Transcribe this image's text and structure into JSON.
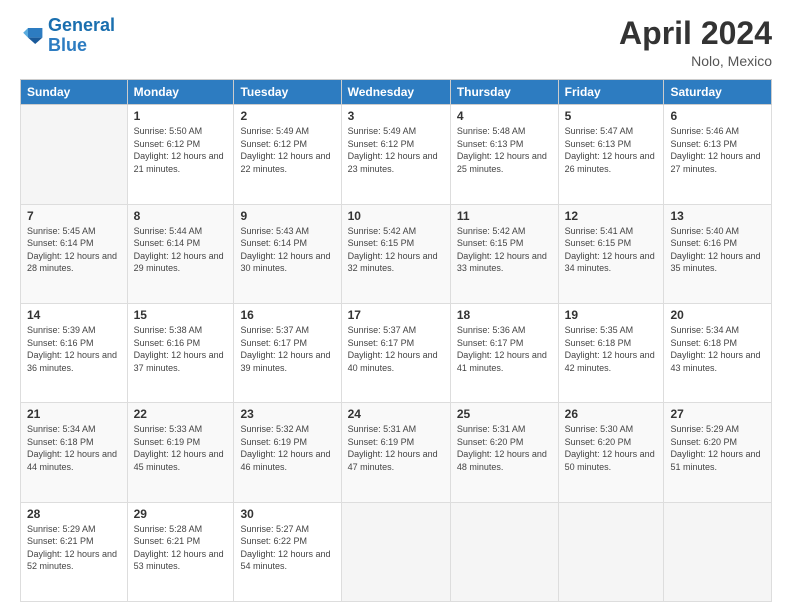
{
  "header": {
    "logo_line1": "General",
    "logo_line2": "Blue",
    "month_title": "April 2024",
    "location": "Nolo, Mexico"
  },
  "weekdays": [
    "Sunday",
    "Monday",
    "Tuesday",
    "Wednesday",
    "Thursday",
    "Friday",
    "Saturday"
  ],
  "weeks": [
    [
      {
        "day": "",
        "sunrise": "",
        "sunset": "",
        "daylight": ""
      },
      {
        "day": "1",
        "sunrise": "Sunrise: 5:50 AM",
        "sunset": "Sunset: 6:12 PM",
        "daylight": "Daylight: 12 hours and 21 minutes."
      },
      {
        "day": "2",
        "sunrise": "Sunrise: 5:49 AM",
        "sunset": "Sunset: 6:12 PM",
        "daylight": "Daylight: 12 hours and 22 minutes."
      },
      {
        "day": "3",
        "sunrise": "Sunrise: 5:49 AM",
        "sunset": "Sunset: 6:12 PM",
        "daylight": "Daylight: 12 hours and 23 minutes."
      },
      {
        "day": "4",
        "sunrise": "Sunrise: 5:48 AM",
        "sunset": "Sunset: 6:13 PM",
        "daylight": "Daylight: 12 hours and 25 minutes."
      },
      {
        "day": "5",
        "sunrise": "Sunrise: 5:47 AM",
        "sunset": "Sunset: 6:13 PM",
        "daylight": "Daylight: 12 hours and 26 minutes."
      },
      {
        "day": "6",
        "sunrise": "Sunrise: 5:46 AM",
        "sunset": "Sunset: 6:13 PM",
        "daylight": "Daylight: 12 hours and 27 minutes."
      }
    ],
    [
      {
        "day": "7",
        "sunrise": "Sunrise: 5:45 AM",
        "sunset": "Sunset: 6:14 PM",
        "daylight": "Daylight: 12 hours and 28 minutes."
      },
      {
        "day": "8",
        "sunrise": "Sunrise: 5:44 AM",
        "sunset": "Sunset: 6:14 PM",
        "daylight": "Daylight: 12 hours and 29 minutes."
      },
      {
        "day": "9",
        "sunrise": "Sunrise: 5:43 AM",
        "sunset": "Sunset: 6:14 PM",
        "daylight": "Daylight: 12 hours and 30 minutes."
      },
      {
        "day": "10",
        "sunrise": "Sunrise: 5:42 AM",
        "sunset": "Sunset: 6:15 PM",
        "daylight": "Daylight: 12 hours and 32 minutes."
      },
      {
        "day": "11",
        "sunrise": "Sunrise: 5:42 AM",
        "sunset": "Sunset: 6:15 PM",
        "daylight": "Daylight: 12 hours and 33 minutes."
      },
      {
        "day": "12",
        "sunrise": "Sunrise: 5:41 AM",
        "sunset": "Sunset: 6:15 PM",
        "daylight": "Daylight: 12 hours and 34 minutes."
      },
      {
        "day": "13",
        "sunrise": "Sunrise: 5:40 AM",
        "sunset": "Sunset: 6:16 PM",
        "daylight": "Daylight: 12 hours and 35 minutes."
      }
    ],
    [
      {
        "day": "14",
        "sunrise": "Sunrise: 5:39 AM",
        "sunset": "Sunset: 6:16 PM",
        "daylight": "Daylight: 12 hours and 36 minutes."
      },
      {
        "day": "15",
        "sunrise": "Sunrise: 5:38 AM",
        "sunset": "Sunset: 6:16 PM",
        "daylight": "Daylight: 12 hours and 37 minutes."
      },
      {
        "day": "16",
        "sunrise": "Sunrise: 5:37 AM",
        "sunset": "Sunset: 6:17 PM",
        "daylight": "Daylight: 12 hours and 39 minutes."
      },
      {
        "day": "17",
        "sunrise": "Sunrise: 5:37 AM",
        "sunset": "Sunset: 6:17 PM",
        "daylight": "Daylight: 12 hours and 40 minutes."
      },
      {
        "day": "18",
        "sunrise": "Sunrise: 5:36 AM",
        "sunset": "Sunset: 6:17 PM",
        "daylight": "Daylight: 12 hours and 41 minutes."
      },
      {
        "day": "19",
        "sunrise": "Sunrise: 5:35 AM",
        "sunset": "Sunset: 6:18 PM",
        "daylight": "Daylight: 12 hours and 42 minutes."
      },
      {
        "day": "20",
        "sunrise": "Sunrise: 5:34 AM",
        "sunset": "Sunset: 6:18 PM",
        "daylight": "Daylight: 12 hours and 43 minutes."
      }
    ],
    [
      {
        "day": "21",
        "sunrise": "Sunrise: 5:34 AM",
        "sunset": "Sunset: 6:18 PM",
        "daylight": "Daylight: 12 hours and 44 minutes."
      },
      {
        "day": "22",
        "sunrise": "Sunrise: 5:33 AM",
        "sunset": "Sunset: 6:19 PM",
        "daylight": "Daylight: 12 hours and 45 minutes."
      },
      {
        "day": "23",
        "sunrise": "Sunrise: 5:32 AM",
        "sunset": "Sunset: 6:19 PM",
        "daylight": "Daylight: 12 hours and 46 minutes."
      },
      {
        "day": "24",
        "sunrise": "Sunrise: 5:31 AM",
        "sunset": "Sunset: 6:19 PM",
        "daylight": "Daylight: 12 hours and 47 minutes."
      },
      {
        "day": "25",
        "sunrise": "Sunrise: 5:31 AM",
        "sunset": "Sunset: 6:20 PM",
        "daylight": "Daylight: 12 hours and 48 minutes."
      },
      {
        "day": "26",
        "sunrise": "Sunrise: 5:30 AM",
        "sunset": "Sunset: 6:20 PM",
        "daylight": "Daylight: 12 hours and 50 minutes."
      },
      {
        "day": "27",
        "sunrise": "Sunrise: 5:29 AM",
        "sunset": "Sunset: 6:20 PM",
        "daylight": "Daylight: 12 hours and 51 minutes."
      }
    ],
    [
      {
        "day": "28",
        "sunrise": "Sunrise: 5:29 AM",
        "sunset": "Sunset: 6:21 PM",
        "daylight": "Daylight: 12 hours and 52 minutes."
      },
      {
        "day": "29",
        "sunrise": "Sunrise: 5:28 AM",
        "sunset": "Sunset: 6:21 PM",
        "daylight": "Daylight: 12 hours and 53 minutes."
      },
      {
        "day": "30",
        "sunrise": "Sunrise: 5:27 AM",
        "sunset": "Sunset: 6:22 PM",
        "daylight": "Daylight: 12 hours and 54 minutes."
      },
      {
        "day": "",
        "sunrise": "",
        "sunset": "",
        "daylight": ""
      },
      {
        "day": "",
        "sunrise": "",
        "sunset": "",
        "daylight": ""
      },
      {
        "day": "",
        "sunrise": "",
        "sunset": "",
        "daylight": ""
      },
      {
        "day": "",
        "sunrise": "",
        "sunset": "",
        "daylight": ""
      }
    ]
  ]
}
